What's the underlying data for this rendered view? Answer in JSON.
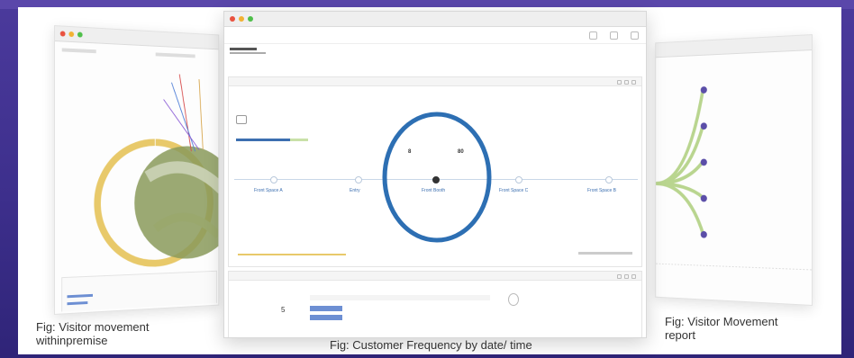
{
  "captions": {
    "left": "Fig: Visitor movement withinpremise",
    "left_line1": "Fig: Visitor movement",
    "left_line2": "withinpremise",
    "center": "Fig: Customer Frequency by date/ time",
    "right_line1": "Fig: Visitor Movement",
    "right_line2": "report"
  },
  "main_window": {
    "zones": [
      "Front Space A",
      "Entry",
      "Front Booth",
      "Front Space C",
      "Front Space B"
    ],
    "stats": [
      "8",
      "80"
    ],
    "big_number": "5"
  },
  "colors": {
    "background": "#3f3190",
    "ring": "#2d6fb3",
    "accent_blue": "#3c6fb0",
    "chord_green": "#8a9a5b",
    "chord_yellow": "#e8c96a",
    "tree_green": "#b9d58f",
    "tree_node": "#5b4ea8"
  }
}
